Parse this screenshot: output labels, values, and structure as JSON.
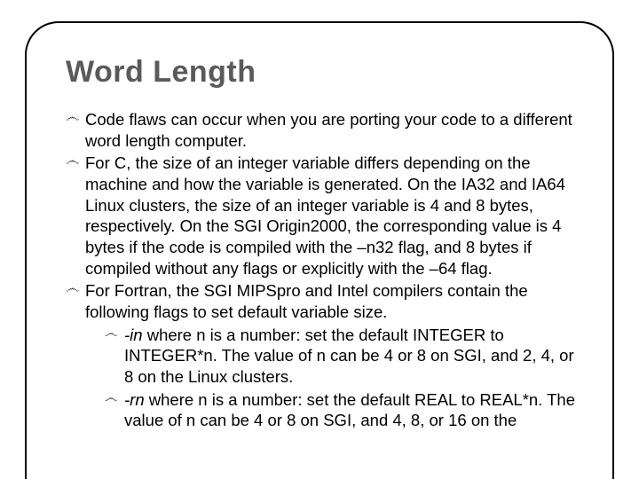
{
  "title": "Word Length",
  "bullets": [
    {
      "text": "Code flaws can occur when you are porting your code to a different word length computer."
    },
    {
      "text": "For C, the size of an integer variable differs depending on the machine and how the variable is generated. On the IA32 and IA64 Linux clusters, the size of an integer variable is 4 and 8 bytes, respectively. On the SGI Origin2000, the corresponding value is 4 bytes if the code is compiled with the –n32 flag, and 8 bytes if compiled without any flags or explicitly with the –64 flag."
    },
    {
      "text": "For Fortran, the SGI MIPSpro and Intel compilers contain the following flags to set default variable size.",
      "sub": [
        {
          "flag": "-in",
          "rest": " where n is a number: set the default INTEGER to INTEGER*n. The value of n can be 4 or 8 on SGI, and 2, 4, or 8 on the Linux clusters."
        },
        {
          "flag": "-rn",
          "rest": " where n is a number: set the default REAL to REAL*n. The value of n can be 4 or 8 on SGI, and 4, 8, or 16 on the"
        }
      ]
    }
  ],
  "bullet_glyph": "෴"
}
